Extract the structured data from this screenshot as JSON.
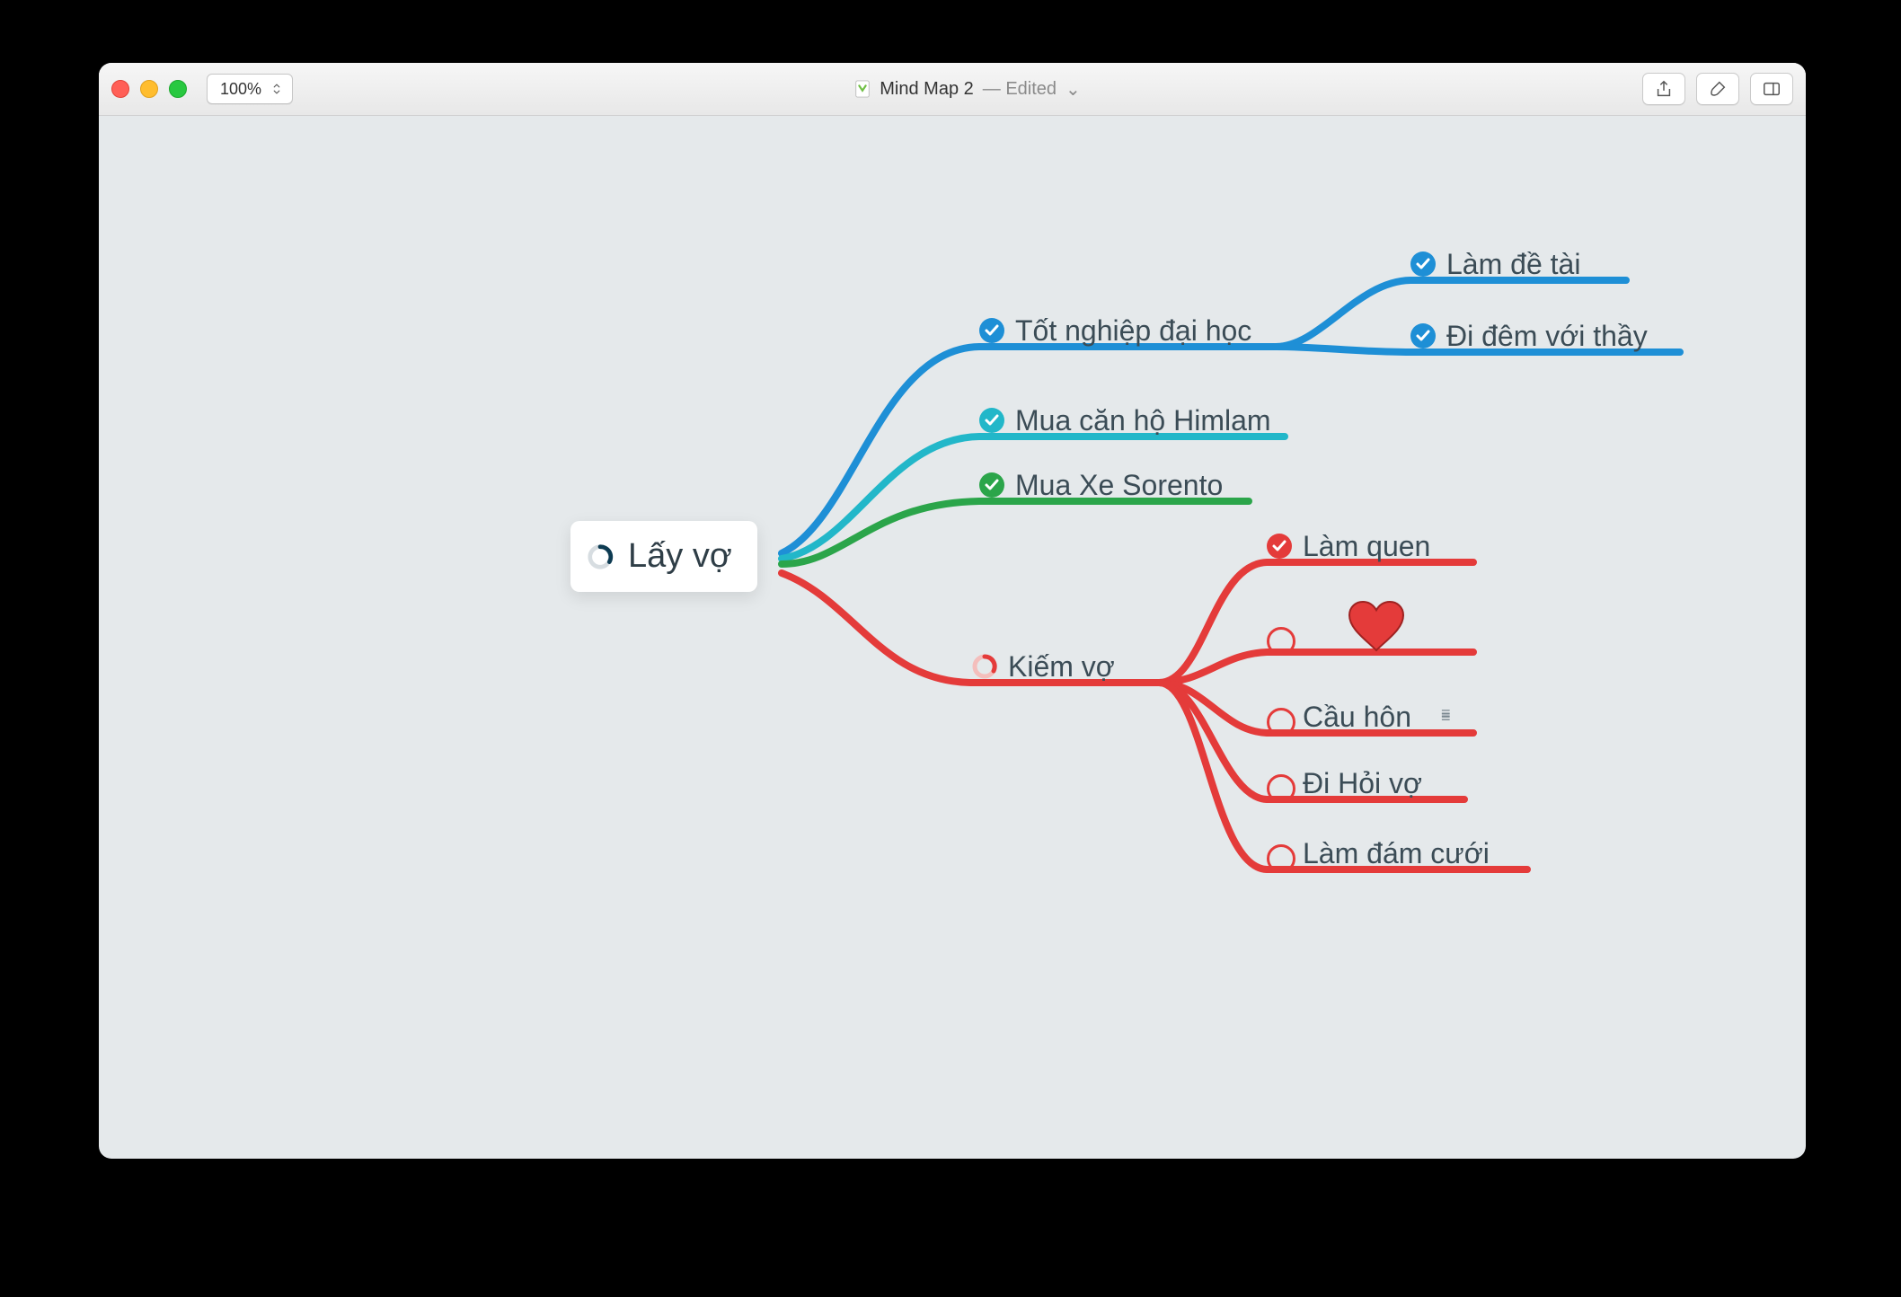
{
  "window": {
    "title": "Mind Map 2",
    "state": "Edited",
    "zoom": "100%"
  },
  "toolbar": {
    "share": "share",
    "format": "format-brush",
    "sidebar": "panels"
  },
  "colors": {
    "blue": "#1e8fd6",
    "teal": "#22b7c9",
    "green": "#2ba54a",
    "red": "#e43b3a",
    "heart": "#e43b3a",
    "text": "#3b4c56"
  },
  "mindmap": {
    "root": {
      "label": "Lấy vợ",
      "progress": "partial"
    },
    "branches": [
      {
        "id": "b1",
        "color": "blue",
        "status": "done",
        "label": "Tốt nghiệp đại học",
        "children": [
          {
            "id": "b1c1",
            "status": "done",
            "label": "Làm đề tài"
          },
          {
            "id": "b1c2",
            "status": "done",
            "label": "Đi đêm với thầy"
          }
        ]
      },
      {
        "id": "b2",
        "color": "teal",
        "status": "done",
        "label": "Mua căn hộ Himlam",
        "children": []
      },
      {
        "id": "b3",
        "color": "green",
        "status": "done",
        "label": "Mua Xe Sorento",
        "children": []
      },
      {
        "id": "b4",
        "color": "red",
        "status": "partial",
        "label": "Kiếm vợ",
        "children": [
          {
            "id": "b4c1",
            "status": "done",
            "label": "Làm quen"
          },
          {
            "id": "b4c2",
            "status": "todo",
            "label": "",
            "icon": "heart"
          },
          {
            "id": "b4c3",
            "status": "todo",
            "label": "Cầu hôn",
            "note": true
          },
          {
            "id": "b4c4",
            "status": "todo",
            "label": "Đi Hỏi vợ"
          },
          {
            "id": "b4c5",
            "status": "todo",
            "label": "Làm đám cưới"
          }
        ]
      }
    ]
  }
}
